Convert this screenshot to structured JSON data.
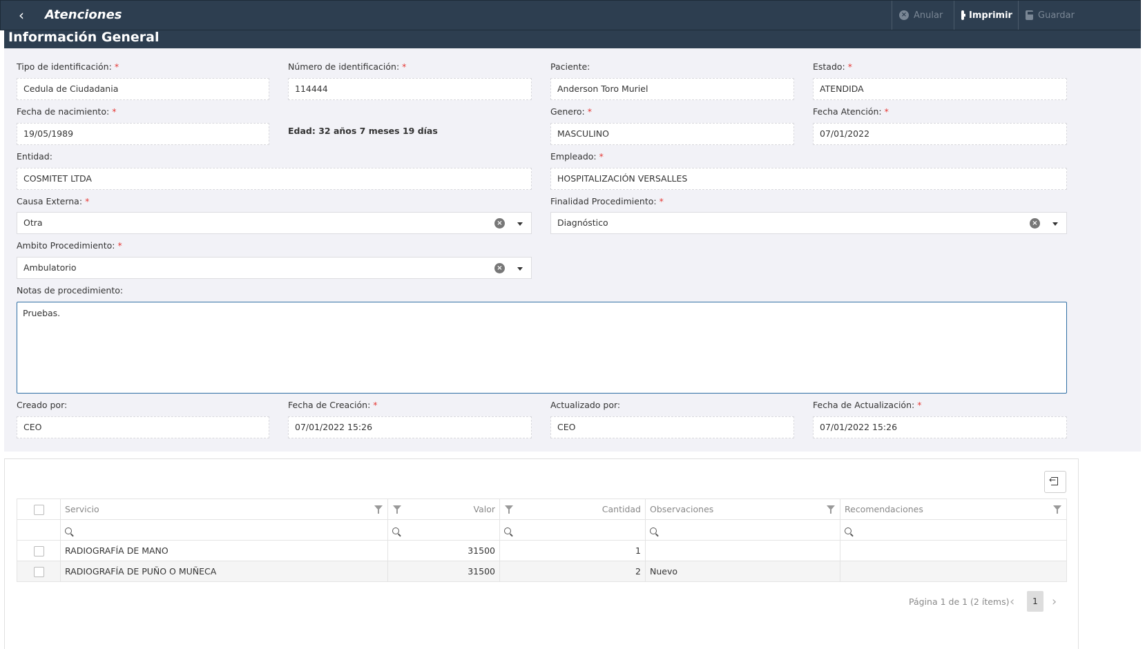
{
  "header": {
    "title": "Atenciones",
    "buttons": {
      "anular": "Anular",
      "imprimir": "Imprimir",
      "guardar": "Guardar"
    }
  },
  "section_title": "Información General",
  "form": {
    "tipo_identificacion": {
      "label": "Tipo de identificación:",
      "value": "Cedula de Ciudadania"
    },
    "numero_identificacion": {
      "label": "Número de identificación:",
      "value": "114444"
    },
    "paciente": {
      "label": "Paciente:",
      "value": "Anderson Toro Muriel"
    },
    "estado": {
      "label": "Estado:",
      "value": "ATENDIDA"
    },
    "fecha_nacimiento": {
      "label": "Fecha de nacimiento:",
      "value": "19/05/1989"
    },
    "edad": "Edad: 32 años 7 meses 19 días",
    "genero": {
      "label": "Genero:",
      "value": "MASCULINO"
    },
    "fecha_atencion": {
      "label": "Fecha Atención:",
      "value": "07/01/2022"
    },
    "entidad": {
      "label": "Entidad:",
      "value": "COSMITET LTDA"
    },
    "empleado": {
      "label": "Empleado:",
      "value": "HOSPITALIZACIÓN  VERSALLES"
    },
    "causa_externa": {
      "label": "Causa Externa:",
      "value": "Otra"
    },
    "finalidad_procedimiento": {
      "label": "Finalidad Procedimiento:",
      "value": "Diagnóstico"
    },
    "ambito_procedimiento": {
      "label": "Ambito Procedimiento:",
      "value": "Ambulatorio"
    },
    "notas": {
      "label": "Notas de procedimiento:",
      "value": "Pruebas."
    },
    "creado_por": {
      "label": "Creado por:",
      "value": "CEO"
    },
    "fecha_creacion": {
      "label": "Fecha de Creación:",
      "value": "07/01/2022 15:26"
    },
    "actualizado_por": {
      "label": "Actualizado por:",
      "value": "CEO"
    },
    "fecha_actualizacion": {
      "label": "Fecha de Actualización:",
      "value": "07/01/2022 15:26"
    },
    "required_mark": "*"
  },
  "grid": {
    "columns": [
      "Servicio",
      "Valor",
      "Cantidad",
      "Observaciones",
      "Recomendaciones"
    ],
    "rows": [
      {
        "servicio": "RADIOGRAFÍA DE MANO",
        "valor": "31500",
        "cantidad": "1",
        "observaciones": "",
        "recomendaciones": ""
      },
      {
        "servicio": "RADIOGRAFÍA DE PUÑO O MUÑECA",
        "valor": "31500",
        "cantidad": "2",
        "observaciones": "Nuevo",
        "recomendaciones": ""
      }
    ],
    "pager": {
      "info": "Página 1 de 1 (2 ítems)",
      "current_page": "1"
    }
  },
  "colors": {
    "header_bg": "#2d3e50",
    "panel_bg": "#f2f2f7",
    "required": "#e53935",
    "focus_border": "#2d6da3"
  },
  "icons": [
    "chevron-left-icon",
    "cancel-circle-icon",
    "print-icon",
    "save-icon",
    "clear-icon",
    "caret-down-icon",
    "filter-icon",
    "search-icon",
    "export-icon"
  ]
}
